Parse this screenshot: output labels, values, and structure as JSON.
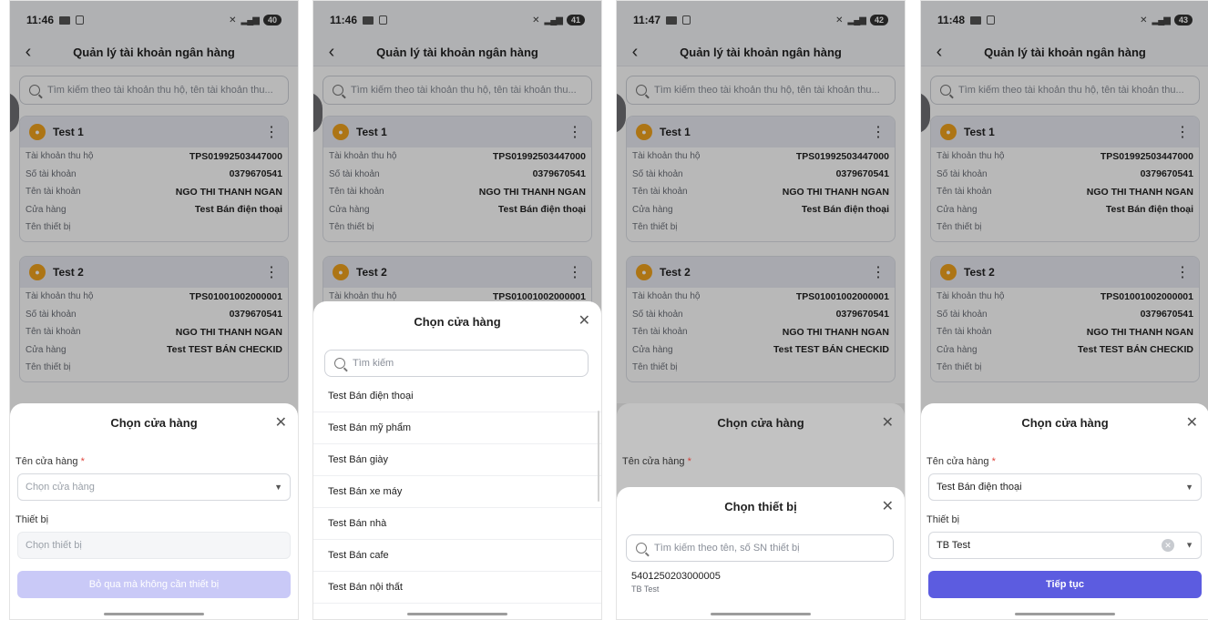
{
  "screens": [
    {
      "status": {
        "time": "11:46",
        "battery": "40"
      },
      "title": "Quản lý tài khoản ngân hàng",
      "search_placeholder": "Tìm kiếm theo tài khoản thu hộ, tên tài khoản thu...",
      "cards": [
        {
          "name": "Test 1",
          "rows": [
            {
              "k": "Tài khoản thu hộ",
              "v": "TPS01992503447000"
            },
            {
              "k": "Số tài khoản",
              "v": "0379670541"
            },
            {
              "k": "Tên tài khoản",
              "v": "NGO THI THANH NGAN"
            },
            {
              "k": "Cửa hàng",
              "v": "Test Bán điện thoại"
            },
            {
              "k": "Tên thiết bị",
              "v": ""
            }
          ]
        },
        {
          "name": "Test 2",
          "rows": [
            {
              "k": "Tài khoản thu hộ",
              "v": "TPS01001002000001"
            },
            {
              "k": "Số tài khoản",
              "v": "0379670541"
            },
            {
              "k": "Tên tài khoản",
              "v": "NGO THI THANH NGAN"
            },
            {
              "k": "Cửa hàng",
              "v": "Test TEST BÁN CHECKID"
            },
            {
              "k": "Tên thiết bị",
              "v": ""
            }
          ]
        }
      ],
      "sheet": {
        "title": "Chọn cửa hàng",
        "store_label": "Tên cửa hàng",
        "required_mark": "*",
        "store_placeholder": "Chọn cửa hàng",
        "device_label": "Thiết bị",
        "device_placeholder": "Chọn thiết bị",
        "button": "Bỏ qua mà không cần thiết bị"
      }
    },
    {
      "status": {
        "time": "11:46",
        "battery": "41"
      },
      "title": "Quản lý tài khoản ngân hàng",
      "search_placeholder": "Tìm kiếm theo tài khoản thu hộ, tên tài khoản thu...",
      "cards": [
        {
          "name": "Test 1",
          "rows": [
            {
              "k": "Tài khoản thu hộ",
              "v": "TPS01992503447000"
            },
            {
              "k": "Số tài khoản",
              "v": "0379670541"
            },
            {
              "k": "Tên tài khoản",
              "v": "NGO THI THANH NGAN"
            },
            {
              "k": "Cửa hàng",
              "v": "Test Bán điện thoại"
            },
            {
              "k": "Tên thiết bị",
              "v": ""
            }
          ]
        },
        {
          "name": "Test 2",
          "rows": [
            {
              "k": "Tài khoản thu hộ",
              "v": "TPS01001002000001"
            }
          ]
        }
      ],
      "sheet": {
        "title": "Chọn cửa hàng",
        "search_placeholder": "Tìm kiếm",
        "stores": [
          "Test Bán điện thoại",
          "Test Bán mỹ phẩm",
          "Test Bán giày",
          "Test Bán xe máy",
          "Test Bán nhà",
          "Test Bán cafe",
          "Test Bán nội thất"
        ]
      }
    },
    {
      "status": {
        "time": "11:47",
        "battery": "42"
      },
      "title": "Quản lý tài khoản ngân hàng",
      "search_placeholder": "Tìm kiếm theo tài khoản thu hộ, tên tài khoản thu...",
      "cards": [
        {
          "name": "Test 1",
          "rows": [
            {
              "k": "Tài khoản thu hộ",
              "v": "TPS01992503447000"
            },
            {
              "k": "Số tài khoản",
              "v": "0379670541"
            },
            {
              "k": "Tên tài khoản",
              "v": "NGO THI THANH NGAN"
            },
            {
              "k": "Cửa hàng",
              "v": "Test Bán điện thoại"
            },
            {
              "k": "Tên thiết bị",
              "v": ""
            }
          ]
        },
        {
          "name": "Test 2",
          "rows": [
            {
              "k": "Tài khoản thu hộ",
              "v": "TPS01001002000001"
            },
            {
              "k": "Số tài khoản",
              "v": "0379670541"
            },
            {
              "k": "Tên tài khoản",
              "v": "NGO THI THANH NGAN"
            },
            {
              "k": "Cửa hàng",
              "v": "Test TEST BÁN CHECKID"
            },
            {
              "k": "Tên thiết bị",
              "v": ""
            }
          ]
        }
      ],
      "sheet": {
        "title": "Chọn cửa hàng",
        "store_label": "Tên cửa hàng",
        "required_mark": "*"
      },
      "sheet2": {
        "title": "Chọn thiết bị",
        "search_placeholder": "Tìm kiếm theo tên, số SN thiết bị",
        "device_code": "5401250203000005",
        "device_name": "TB Test"
      }
    },
    {
      "status": {
        "time": "11:48",
        "battery": "43"
      },
      "title": "Quản lý tài khoản ngân hàng",
      "search_placeholder": "Tìm kiếm theo tài khoản thu hộ, tên tài khoản thu...",
      "cards": [
        {
          "name": "Test 1",
          "rows": [
            {
              "k": "Tài khoản thu hộ",
              "v": "TPS01992503447000"
            },
            {
              "k": "Số tài khoản",
              "v": "0379670541"
            },
            {
              "k": "Tên tài khoản",
              "v": "NGO THI THANH NGAN"
            },
            {
              "k": "Cửa hàng",
              "v": "Test Bán điện thoại"
            },
            {
              "k": "Tên thiết bị",
              "v": ""
            }
          ]
        },
        {
          "name": "Test 2",
          "rows": [
            {
              "k": "Tài khoản thu hộ",
              "v": "TPS01001002000001"
            },
            {
              "k": "Số tài khoản",
              "v": "0379670541"
            },
            {
              "k": "Tên tài khoản",
              "v": "NGO THI THANH NGAN"
            },
            {
              "k": "Cửa hàng",
              "v": "Test TEST BÁN CHECKID"
            },
            {
              "k": "Tên thiết bị",
              "v": ""
            }
          ]
        }
      ],
      "sheet": {
        "title": "Chọn cửa hàng",
        "store_label": "Tên cửa hàng",
        "required_mark": "*",
        "store_value": "Test Bán điện thoại",
        "device_label": "Thiết bị",
        "device_value": "TB Test",
        "button": "Tiếp tục"
      }
    }
  ]
}
